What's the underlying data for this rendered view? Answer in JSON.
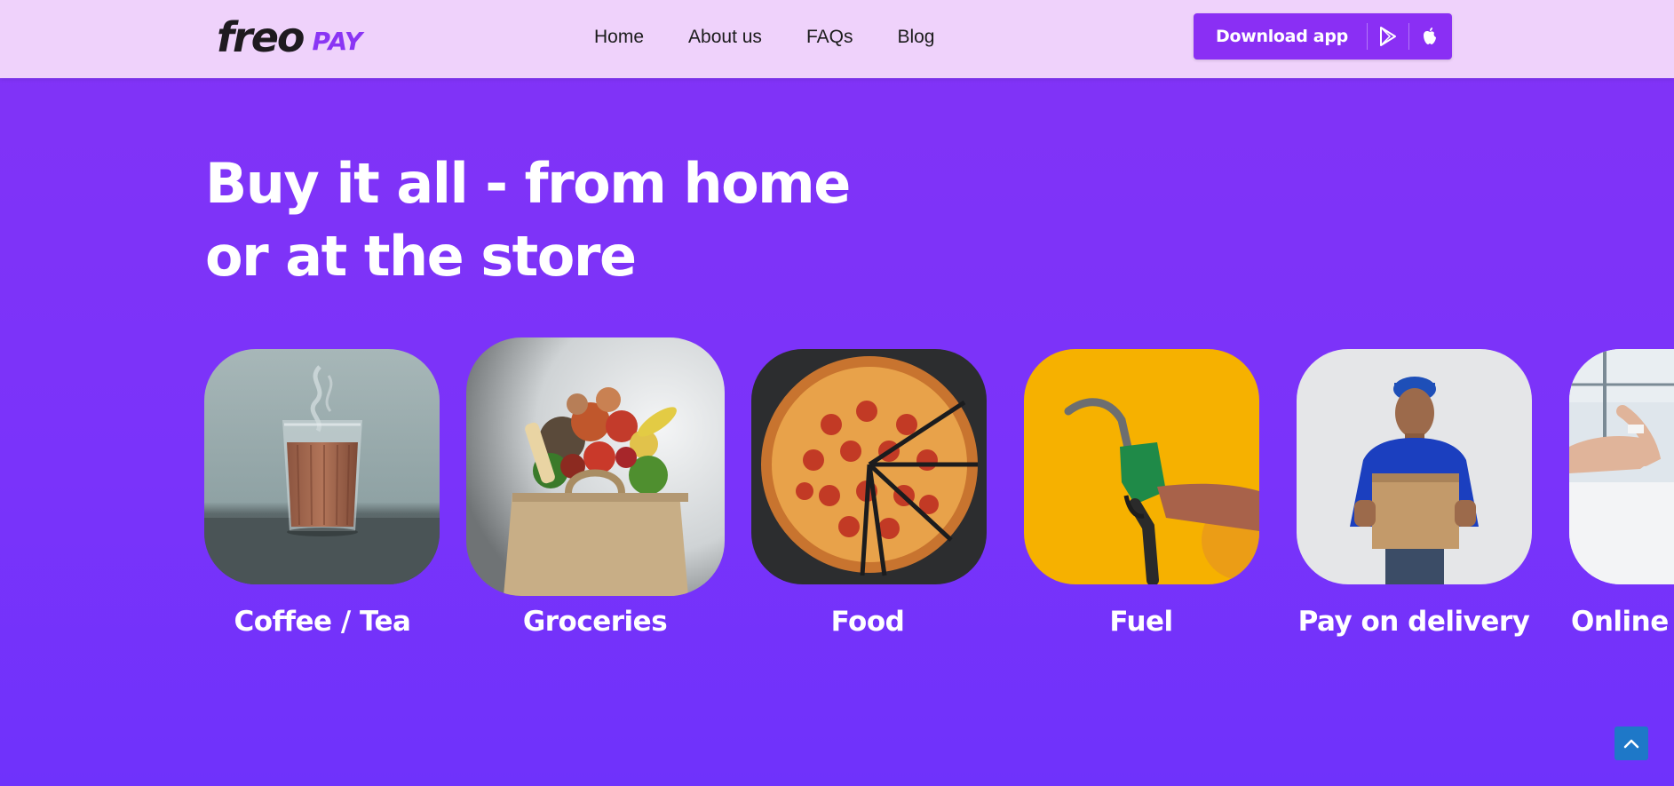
{
  "header": {
    "logo_word": "freo",
    "logo_pay": "PAY",
    "nav": [
      "Home",
      "About us",
      "FAQs",
      "Blog"
    ],
    "download_label": "Download app",
    "download_icons": [
      "play-store-icon",
      "apple-icon"
    ]
  },
  "hero": {
    "title_line1": "Buy it all - from home",
    "title_line2": "or at the store"
  },
  "categories": [
    {
      "label": "Coffee / Tea",
      "image": "chai-glass"
    },
    {
      "label": "Groceries",
      "image": "grocery-bag"
    },
    {
      "label": "Food",
      "image": "pepperoni-pizza"
    },
    {
      "label": "Fuel",
      "image": "fuel-nozzle"
    },
    {
      "label": "Pay on delivery",
      "image": "delivery-man"
    },
    {
      "label": "Online s",
      "image": "online-shopping"
    }
  ],
  "colors": {
    "header_bg": "#efd2fb",
    "hero_bg": "#8233f6",
    "accent": "#8a2ff4",
    "scroll_top": "#1e78c8"
  },
  "scroll_top": {
    "icon": "chevron-up-icon"
  }
}
